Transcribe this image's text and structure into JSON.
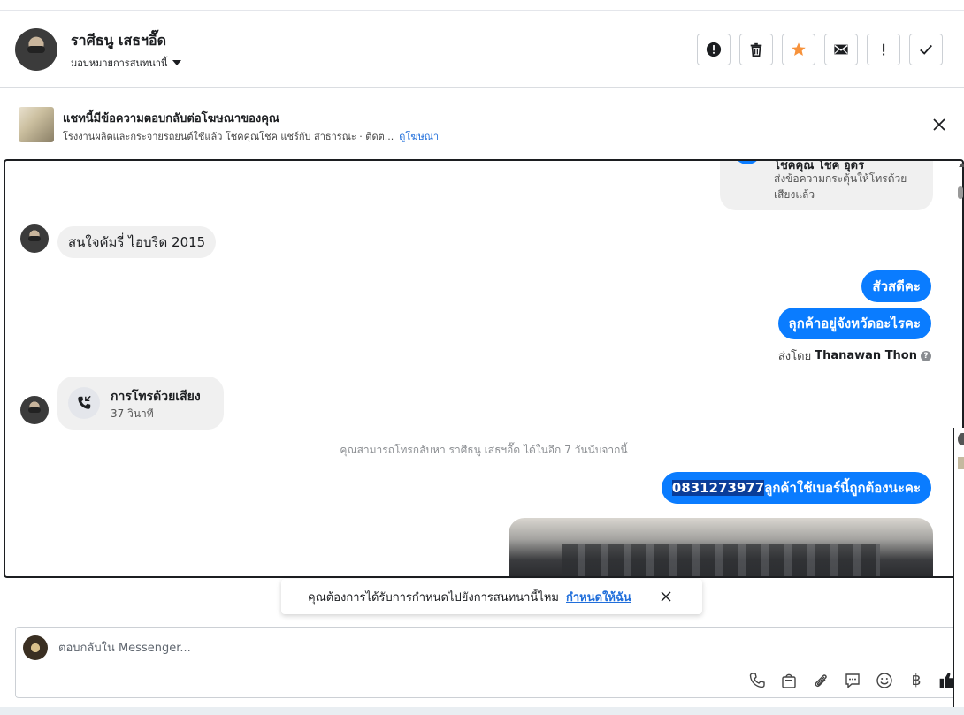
{
  "header": {
    "contact_name": "ราศีธนู เสธฯอื๊ด",
    "assign_label": "มอบหมายการสนทนานี้",
    "toolbar": [
      {
        "name": "mark-spam-button",
        "icon": "alert-circle-icon"
      },
      {
        "name": "delete-button",
        "icon": "trash-icon"
      },
      {
        "name": "star-button",
        "icon": "star-icon"
      },
      {
        "name": "mark-unread-button",
        "icon": "envelope-icon"
      },
      {
        "name": "follow-up-button",
        "icon": "exclamation-icon"
      },
      {
        "name": "mark-done-button",
        "icon": "check-icon"
      }
    ]
  },
  "ad_banner": {
    "title": "แชทนี้มีข้อความตอบกลับต่อโฆษณาของคุณ",
    "description": "โรงงานผลิตและกระจายรถยนต์ใช้แล้ว โชคคุณโชค แชร์กับ สาธารณะ · ติดต...",
    "link": "ดูโฆษณา"
  },
  "chat": {
    "top_card": {
      "title": "โชคคุณ โชค อุดร",
      "description": "ส่งข้อความกระตุ้นให้โทรด้วยเสียงแล้ว"
    },
    "incoming_1": "สนใจคัมรี่ ไฮบริด 2015",
    "outgoing_1": "สัวสดีคะ",
    "outgoing_2": "ลุกค้าอยู่จังหวัดอะไรคะ",
    "sent_by_prefix": "ส่งโดย",
    "sent_by_name": "Thanawan Thon",
    "call": {
      "title": "การโทรด้วยเสียง",
      "duration": "37 วินาที"
    },
    "callback_note": "คุณสามารถโทรกลับหา ราศีธนู เสธฯอื๊ด ได้ในอีก 7 วันนับจากนี้",
    "outgoing_3_selected": "0831273977",
    "outgoing_3_rest": "ลูกค้าใช้เบอร์นี้ถูกต้องนะคะ"
  },
  "toast": {
    "text": "คุณต้องการได้รับการกำหนดไปยังการสนทนานี้ไหม",
    "action": "กำหนดให้ฉัน"
  },
  "composer": {
    "placeholder": "ตอบกลับใน Messenger...",
    "tools": [
      "phone-icon",
      "shopping-bag-icon",
      "paperclip-icon",
      "saved-reply-icon",
      "emoji-icon",
      "baht-icon",
      "like-icon"
    ]
  },
  "colors": {
    "accent": "#0a7cff",
    "star": "#f7923b",
    "link": "#216fdb"
  }
}
